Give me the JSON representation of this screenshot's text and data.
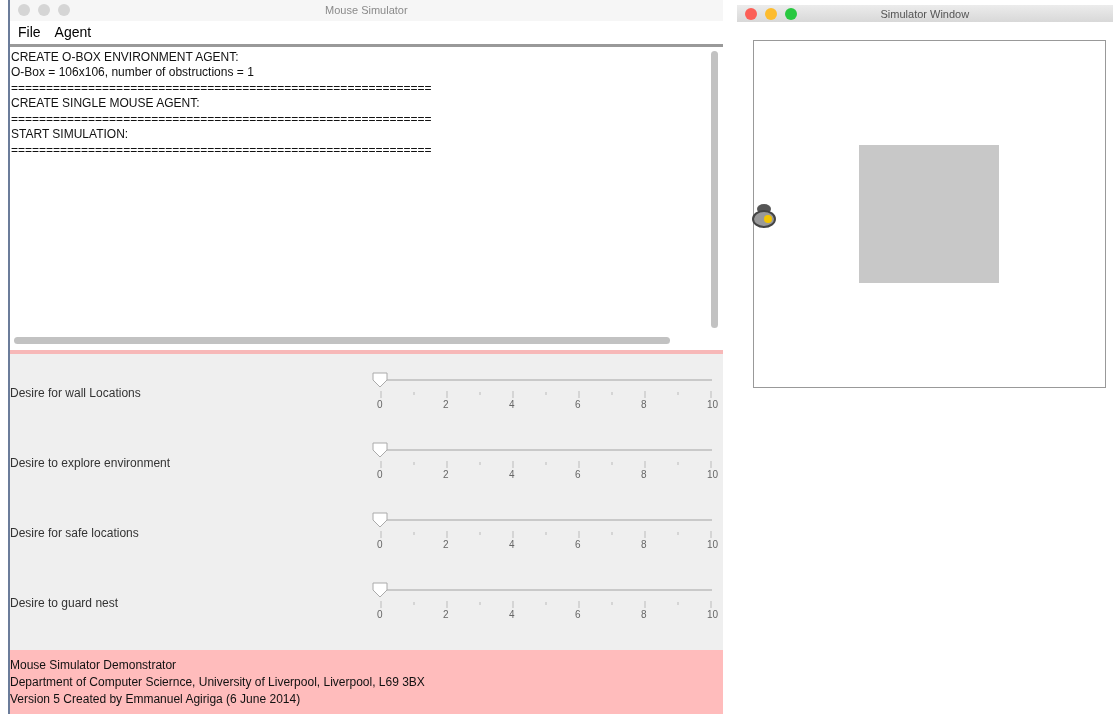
{
  "main_window": {
    "title": "Mouse Simulator",
    "menu": [
      "File",
      "Agent"
    ],
    "log": [
      "CREATE O-BOX ENVIRONMENT AGENT:",
      "O-Box = 106x106, number of obstructions = 1",
      "============================================================",
      "CREATE SINGLE MOUSE AGENT:",
      "============================================================",
      "START SIMULATION:",
      "============================================================"
    ],
    "sliders": [
      {
        "label": "Desire for wall Locations",
        "level": 0,
        "tick_labels": [
          "0",
          "2",
          "4",
          "6",
          "8",
          "10"
        ]
      },
      {
        "label": "Desire to explore environment",
        "level": 0,
        "tick_labels": [
          "0",
          "2",
          "4",
          "6",
          "8",
          "10"
        ]
      },
      {
        "label": "Desire for safe locations",
        "level": 0,
        "tick_labels": [
          "0",
          "2",
          "4",
          "6",
          "8",
          "10"
        ]
      },
      {
        "label": "Desire to guard nest",
        "level": 0,
        "tick_labels": [
          "0",
          "2",
          "4",
          "6",
          "8",
          "10"
        ]
      }
    ],
    "footer": [
      "Mouse Simulator Demonstrator",
      "Department of Computer Sciernce, University of Liverpool, Liverpool, L69 3BX",
      "Version 5 Created by Emmanuel Agiriga (6 June 2014)"
    ]
  },
  "simulator_window": {
    "title": "Simulator Window",
    "window_buttons": [
      {
        "kind": "close"
      },
      {
        "kind": "minimize"
      },
      {
        "kind": "zoom"
      }
    ]
  }
}
